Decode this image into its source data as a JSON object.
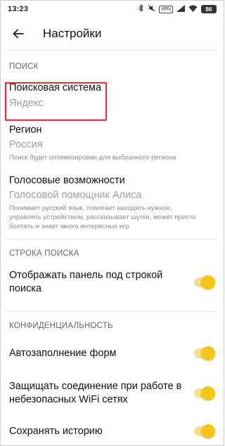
{
  "status_bar": {
    "time": "13:23",
    "vpn": "VPN",
    "battery": "86"
  },
  "app_bar": {
    "title": "Настройки"
  },
  "sections": {
    "search": {
      "header": "ПОИСК",
      "engine": {
        "title": "Поисковая система",
        "value": "Яндекс"
      },
      "region": {
        "title": "Регион",
        "value": "Россия",
        "desc": "Поиск будет оптимизирован для выбранного региона"
      },
      "voice": {
        "title": "Голосовые возможности",
        "value": "Голосовой помощник Алиса",
        "desc": "Понимает русский язык, помогает находить нужное, управлять устройством, рассказывает шутки, может просто болтать и знает много интересных игр"
      }
    },
    "search_bar": {
      "header": "СТРОКА ПОИСКА",
      "show_panel": {
        "title": "Отображать панель под строкой поиска",
        "enabled": true
      }
    },
    "privacy": {
      "header": "КОНФИДЕНЦИАЛЬНОСТЬ",
      "autofill": {
        "title": "Автозаполнение форм",
        "enabled": true
      },
      "wifi_protect": {
        "title": "Защищать соединение при работе в небезопасных WiFi сетях",
        "enabled": true
      },
      "save_history": {
        "title": "Сохранять историю",
        "enabled": true
      }
    }
  },
  "colors": {
    "accent": "#f5c518",
    "highlight": "#e0353b"
  }
}
